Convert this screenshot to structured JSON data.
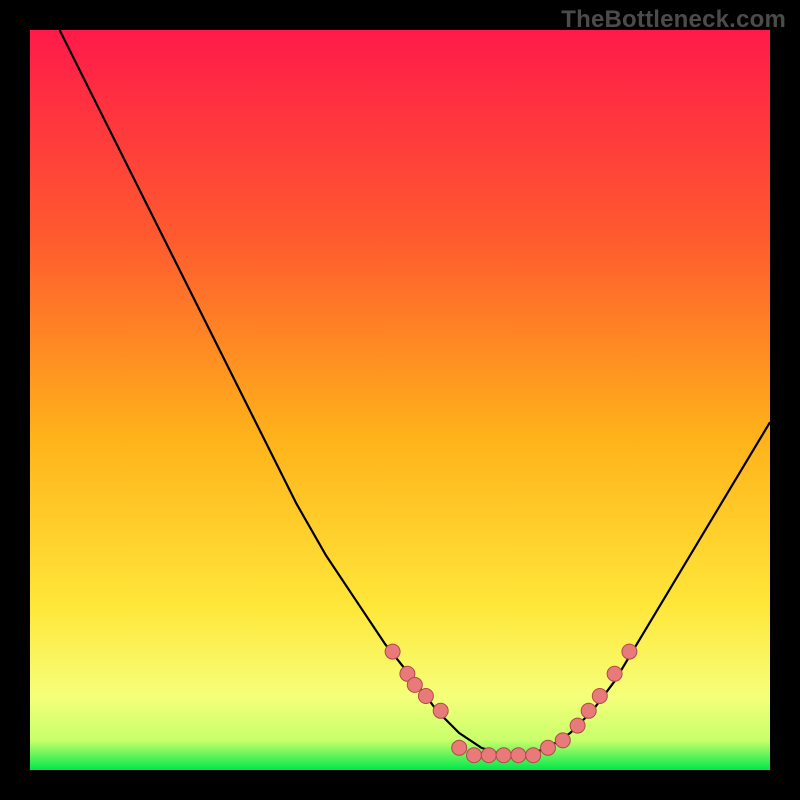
{
  "watermark": "TheBottleneck.com",
  "colors": {
    "background": "#000000",
    "gradient_top": "#ff1a4a",
    "gradient_mid1": "#ff6a2a",
    "gradient_mid2": "#ffd21a",
    "gradient_mid3": "#faff5a",
    "gradient_bottom": "#00e84a",
    "curve": "#000000",
    "dot_fill": "#e87a7a",
    "dot_stroke": "#b04a4a",
    "watermark": "#4b4b4b"
  },
  "chart_data": {
    "type": "line",
    "title": "",
    "xlabel": "",
    "ylabel": "",
    "xlim": [
      0,
      100
    ],
    "ylim": [
      0,
      100
    ],
    "series": [
      {
        "name": "bottleneck-curve",
        "x": [
          4,
          8,
          12,
          16,
          20,
          24,
          28,
          32,
          36,
          40,
          44,
          48,
          52,
          55,
          58,
          61,
          64,
          67,
          70,
          73,
          76,
          79,
          82,
          85,
          88,
          91,
          94,
          97,
          100
        ],
        "y": [
          100,
          92,
          84,
          76,
          68,
          60,
          52,
          44,
          36,
          29,
          23,
          17,
          12,
          8,
          5,
          3,
          2,
          2,
          3,
          5,
          8,
          12,
          17,
          22,
          27,
          32,
          37,
          42,
          47
        ]
      }
    ],
    "highlight_dots": {
      "left_cluster": {
        "x": [
          49,
          51,
          52,
          53.5,
          55.5
        ],
        "y": [
          16,
          13,
          11.5,
          10,
          8
        ]
      },
      "bottom_cluster": {
        "x": [
          58,
          60,
          62,
          64,
          66,
          68,
          70,
          72
        ],
        "y": [
          3,
          2,
          2,
          2,
          2,
          2,
          3,
          4
        ]
      },
      "right_cluster": {
        "x": [
          74,
          75.5,
          77,
          79,
          81
        ],
        "y": [
          6,
          8,
          10,
          13,
          16
        ]
      }
    }
  }
}
